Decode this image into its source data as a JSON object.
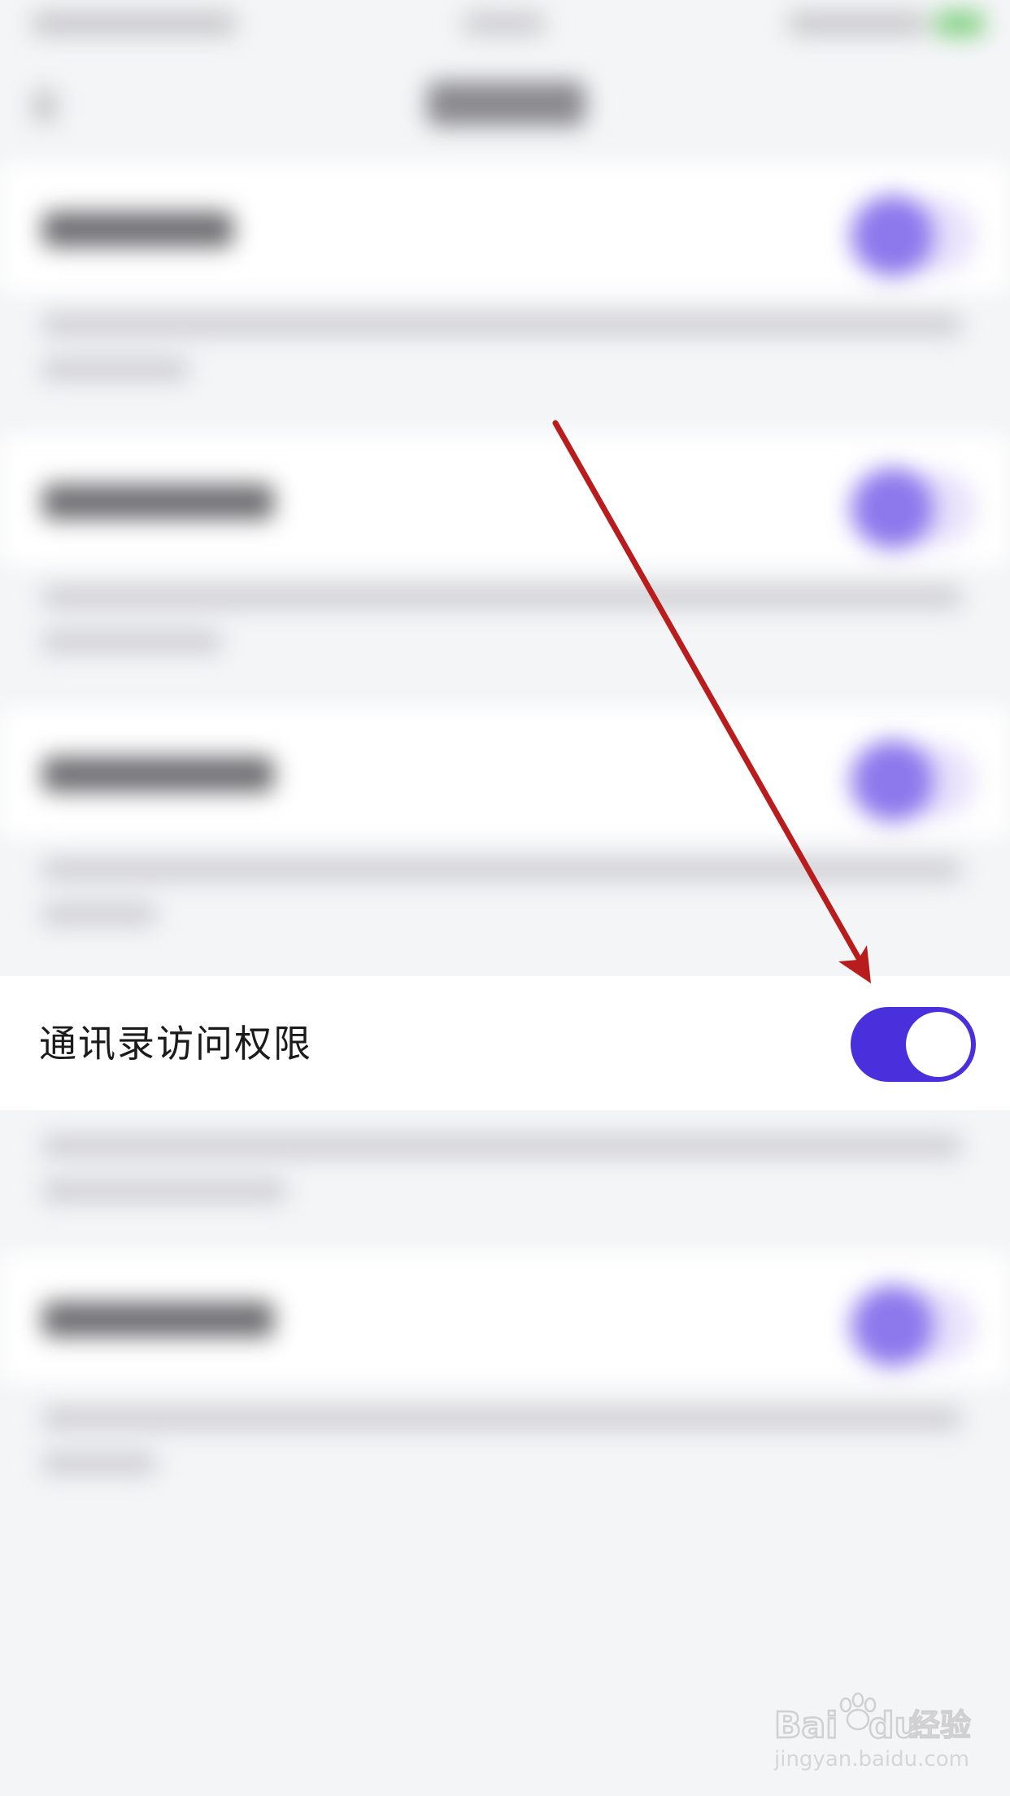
{
  "setting": {
    "label": "通讯录访问权限",
    "enabled": true
  },
  "watermark": {
    "brand_latin": "Bai",
    "brand_latin_2": "du",
    "brand_cn": "经验",
    "url": "jingyan.baidu.com"
  },
  "colors": {
    "toggle_on": "#4a2fdc",
    "arrow": "#b81c1c",
    "background": "#f4f5f7"
  }
}
